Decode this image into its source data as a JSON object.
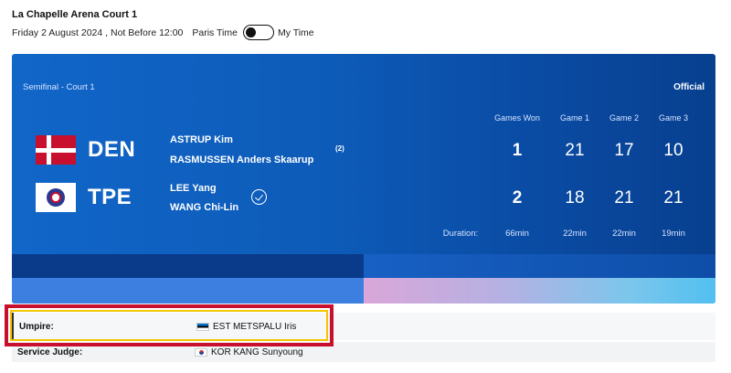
{
  "header": {
    "court_title": "La Chapelle Arena Court 1",
    "date_text": "Friday 2 August 2024 , Not Before 12:00",
    "tz_left": "Paris Time",
    "tz_right": "My Time"
  },
  "match": {
    "stage": "Semifinal - Court 1",
    "status": "Official",
    "columns": {
      "games_won": "Games Won",
      "game1": "Game 1",
      "game2": "Game 2",
      "game3": "Game 3"
    },
    "teams": [
      {
        "country": "DEN",
        "player1": "ASTRUP Kim",
        "player2": "RASMUSSEN Anders Skaarup",
        "seed": "(2)",
        "games_won": "1",
        "game1": "21",
        "game2": "17",
        "game3": "10"
      },
      {
        "country": "TPE",
        "player1": "LEE Yang",
        "player2": "WANG Chi-Lin",
        "winner_icon": "check-circle-icon",
        "games_won": "2",
        "game1": "18",
        "game2": "21",
        "game3": "21"
      }
    ],
    "duration_label": "Duration:",
    "duration_total": "66min",
    "duration_g1": "22min",
    "duration_g2": "22min",
    "duration_g3": "19min"
  },
  "officials": [
    {
      "label": "Umpire:",
      "flag": "EST",
      "name": "EST METSPALU Iris"
    },
    {
      "label": "Service Judge:",
      "flag": "KOR",
      "name": "KOR KANG Sunyoung"
    }
  ],
  "colors": {
    "card_blue": "#0d5bb8",
    "highlight_red": "#c8102e",
    "highlight_yellow": "#f4c400"
  }
}
